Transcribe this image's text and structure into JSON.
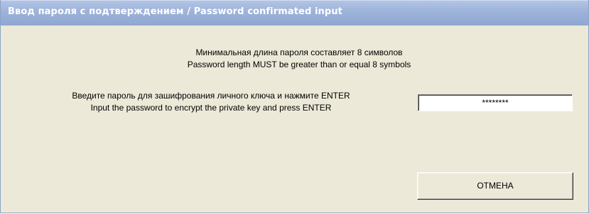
{
  "window": {
    "title": "Ввод пароля с подтверждением / Password confirmated input"
  },
  "info": {
    "line_ru": "Минимальная длина пароля составляет 8 символов",
    "line_en": "Password length MUST be greater than or equal 8 symbols"
  },
  "prompt": {
    "line_ru": "Введите пароль для зашифрования личного ключа и нажмите ENTER",
    "line_en": "Input the password to encrypt the private key and press ENTER"
  },
  "password_field": {
    "value": "********"
  },
  "buttons": {
    "cancel_label": "ОТМЕНА"
  },
  "colors": {
    "titlebar": "#9db3da",
    "dialog_background": "#ece9d8",
    "title_text": "#ffffff"
  }
}
